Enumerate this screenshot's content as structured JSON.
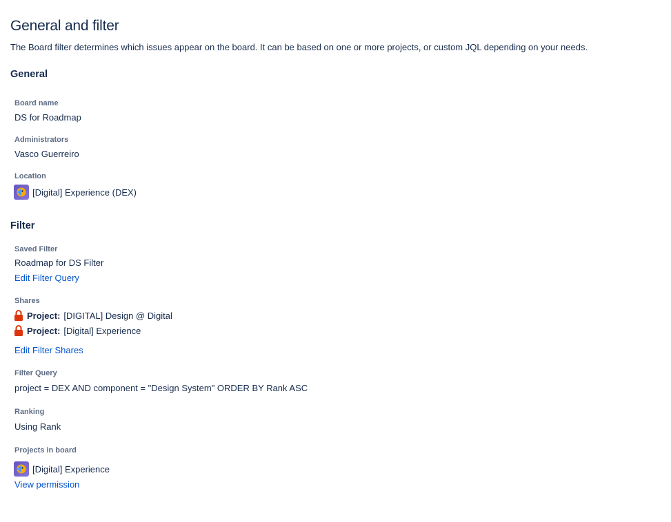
{
  "page": {
    "title": "General and filter",
    "description": "The Board filter determines which issues appear on the board. It can be based on one or more projects, or custom JQL depending on your needs."
  },
  "general": {
    "heading": "General",
    "board_name_label": "Board name",
    "board_name": "DS for Roadmap",
    "administrators_label": "Administrators",
    "administrators": "Vasco Guerreiro",
    "location_label": "Location",
    "location": "[Digital] Experience (DEX)"
  },
  "filter": {
    "heading": "Filter",
    "saved_filter_label": "Saved Filter",
    "saved_filter": "Roadmap for DS Filter",
    "edit_filter_query": "Edit Filter Query",
    "shares_label": "Shares",
    "shares": [
      {
        "prefix": "Project:",
        "name": "[DIGITAL] Design @ Digital"
      },
      {
        "prefix": "Project:",
        "name": "[Digital] Experience"
      }
    ],
    "edit_filter_shares": "Edit Filter Shares",
    "filter_query_label": "Filter Query",
    "filter_query": "project = DEX AND component = \"Design System\" ORDER BY Rank ASC",
    "ranking_label": "Ranking",
    "ranking": "Using Rank",
    "projects_label": "Projects in board",
    "project": "[Digital] Experience",
    "view_permission": "View permission"
  },
  "icons": {
    "project_avatar": "project-avatar-icon",
    "lock": "lock-icon"
  },
  "colors": {
    "link": "#0052cc",
    "lock": "#de350b",
    "avatar": "#6554c0"
  }
}
